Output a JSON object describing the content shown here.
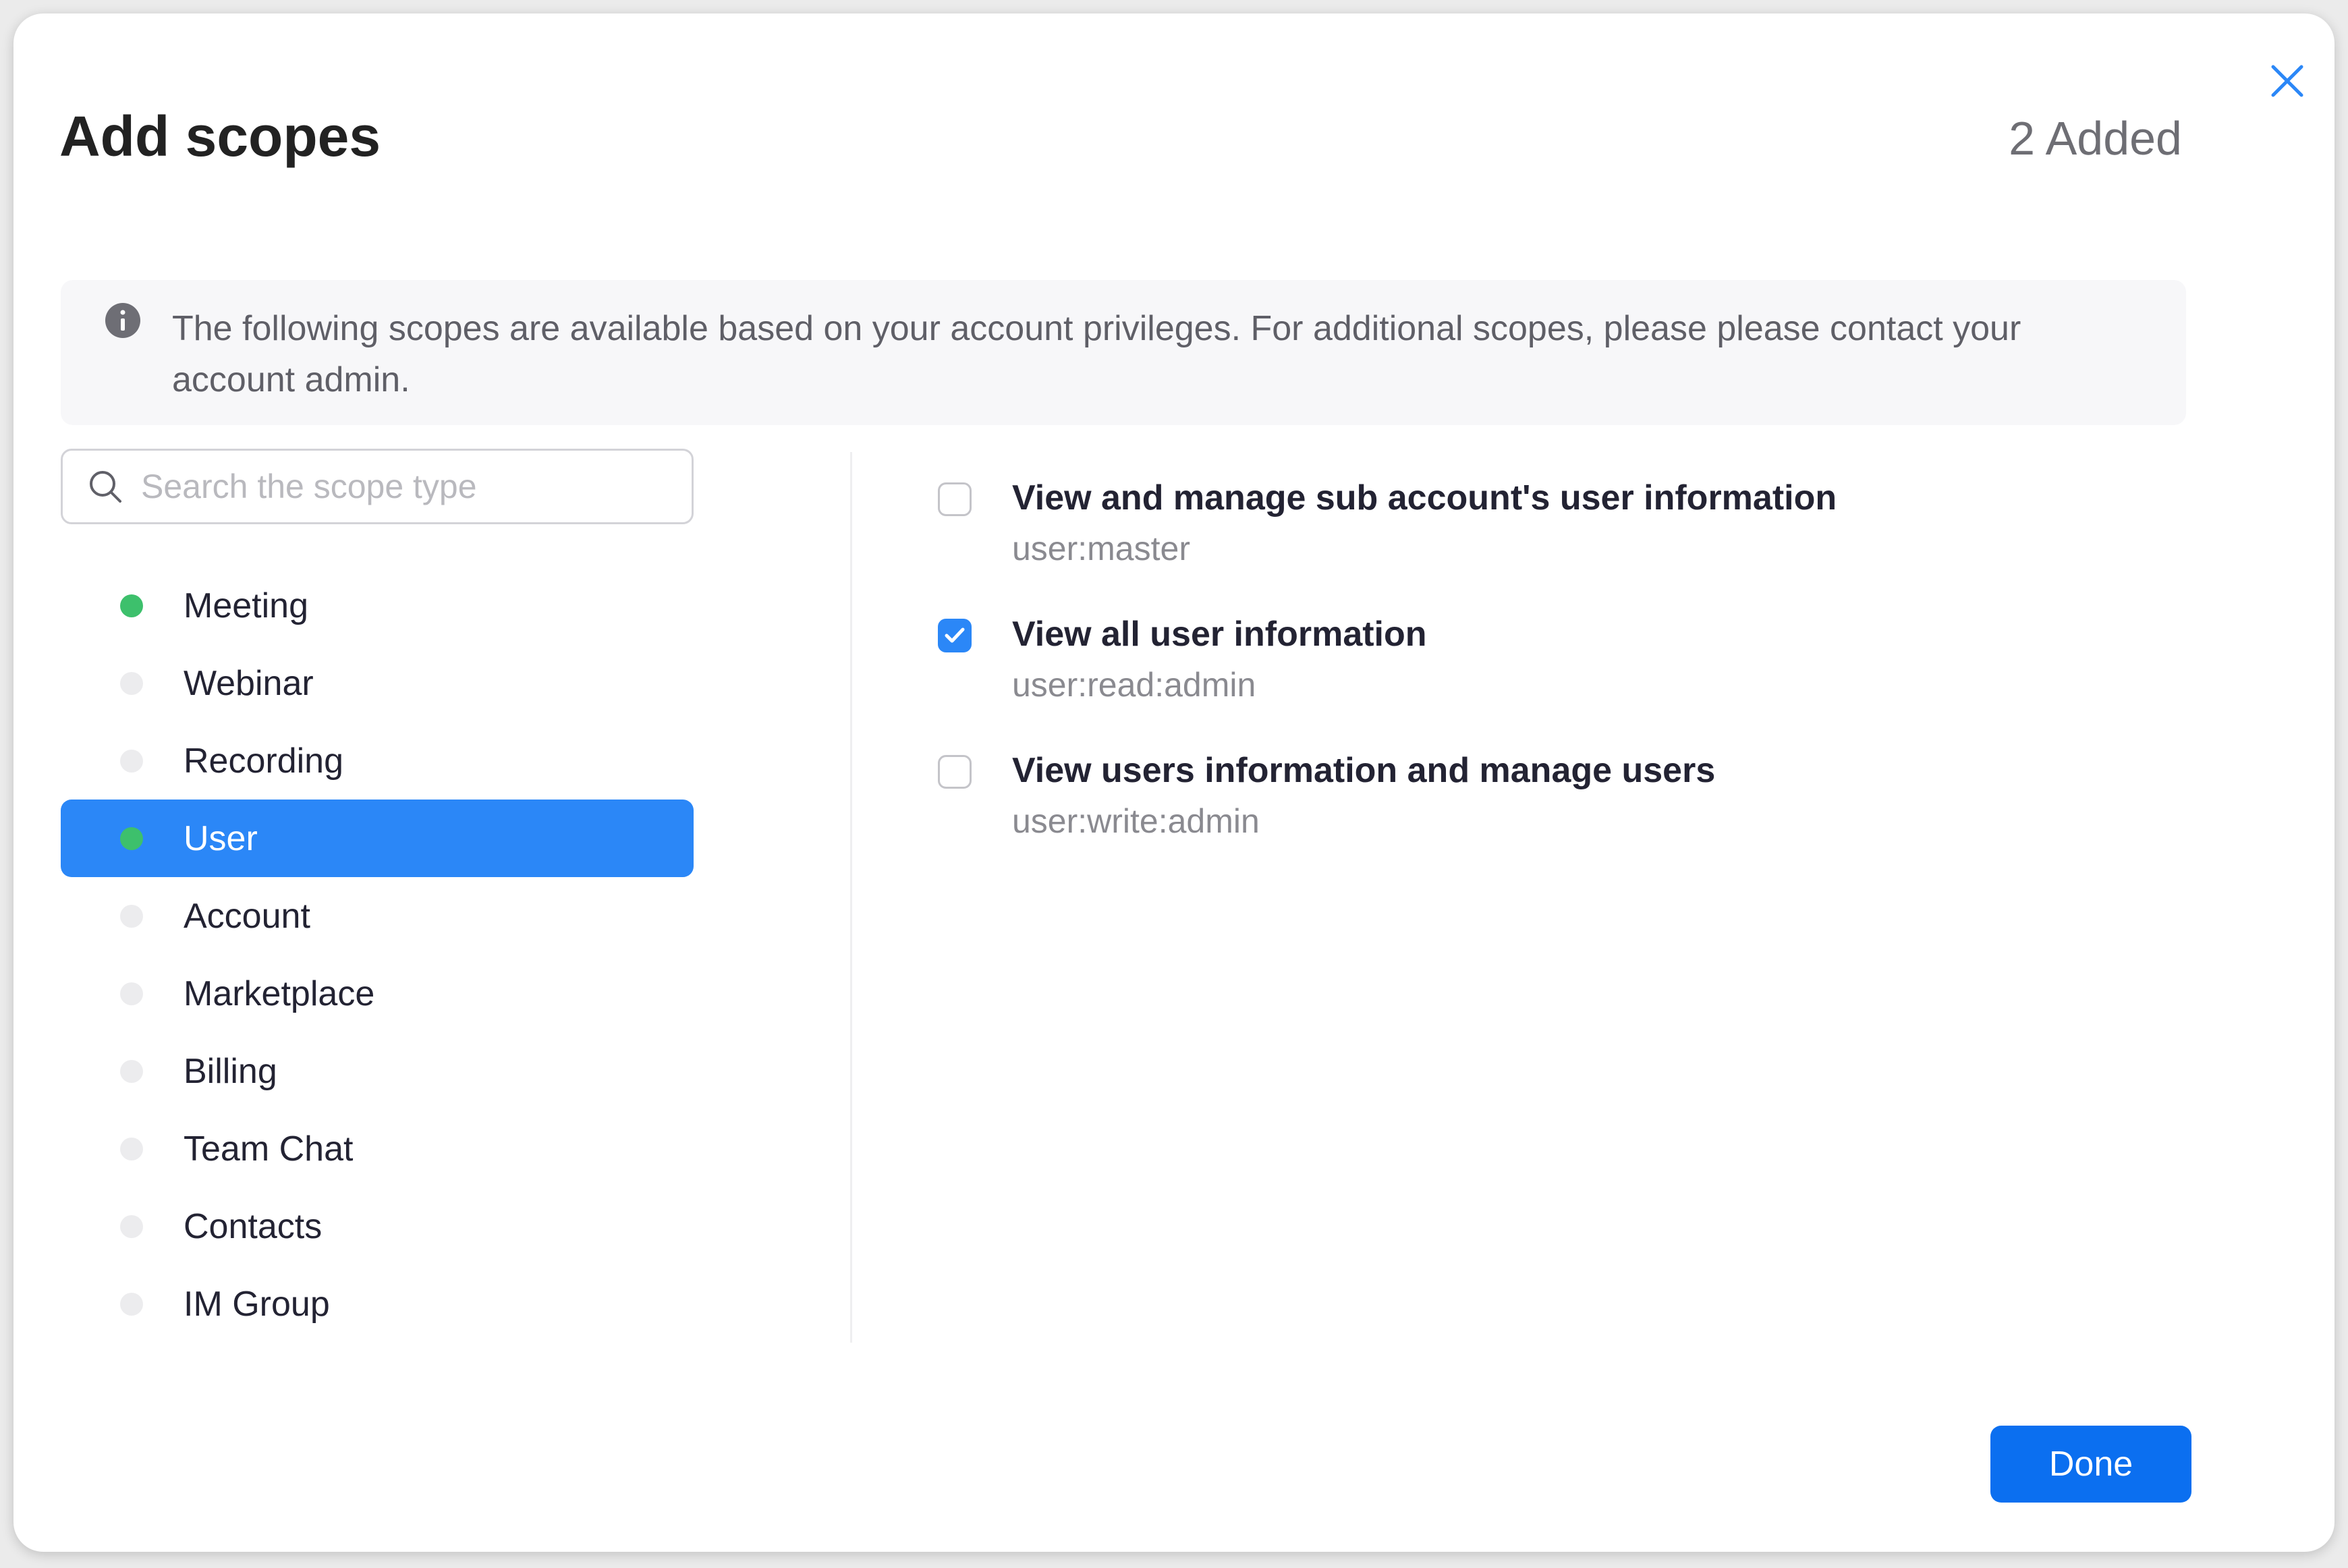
{
  "dialog": {
    "title": "Add scopes",
    "added_count": "2 Added"
  },
  "info_banner": {
    "text": "The following scopes are available based on your account privileges. For additional scopes, please please contact your account admin."
  },
  "search": {
    "placeholder": "Search the scope type",
    "value": ""
  },
  "categories": [
    {
      "label": "Meeting",
      "has_selection": true,
      "selected": false
    },
    {
      "label": "Webinar",
      "has_selection": false,
      "selected": false
    },
    {
      "label": "Recording",
      "has_selection": false,
      "selected": false
    },
    {
      "label": "User",
      "has_selection": true,
      "selected": true
    },
    {
      "label": "Account",
      "has_selection": false,
      "selected": false
    },
    {
      "label": "Marketplace",
      "has_selection": false,
      "selected": false
    },
    {
      "label": "Billing",
      "has_selection": false,
      "selected": false
    },
    {
      "label": "Team Chat",
      "has_selection": false,
      "selected": false
    },
    {
      "label": "Contacts",
      "has_selection": false,
      "selected": false
    },
    {
      "label": "IM Group",
      "has_selection": false,
      "selected": false
    }
  ],
  "scopes": [
    {
      "title": "View and manage sub account's user information",
      "code": "user:master",
      "checked": false
    },
    {
      "title": "View all user information",
      "code": "user:read:admin",
      "checked": true
    },
    {
      "title": "View users information and manage users",
      "code": "user:write:admin",
      "checked": false
    }
  ],
  "actions": {
    "done_label": "Done"
  },
  "colors": {
    "accent": "#2b87f7",
    "selected_dot": "#3dc06c",
    "unselected_dot": "#ececee"
  },
  "icons": {
    "close": "close-icon",
    "info": "info-icon",
    "search": "search-icon",
    "check": "check-icon"
  }
}
